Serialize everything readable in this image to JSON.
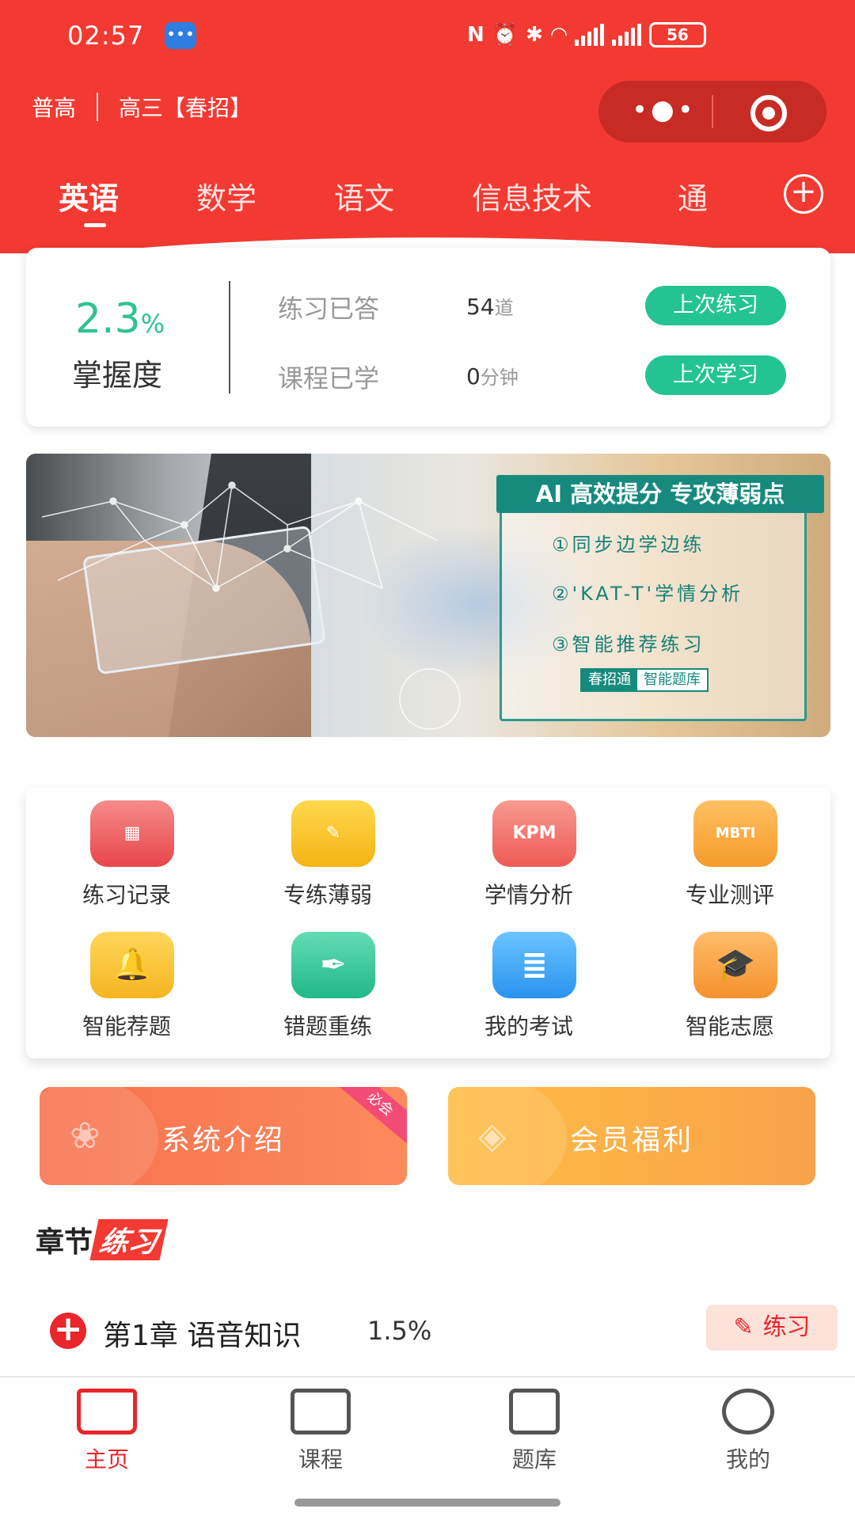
{
  "status_bar": {
    "time": "02:57",
    "battery": "56"
  },
  "header": {
    "level": "普高",
    "grade": "高三【春招】"
  },
  "tabs": [
    "英语",
    "数学",
    "语文",
    "信息技术",
    "通"
  ],
  "stats": {
    "mastery_value": "2.3",
    "mastery_unit": "%",
    "mastery_label": "掌握度",
    "rows": [
      {
        "label": "练习已答",
        "value": "54",
        "unit": "道",
        "button": "上次练习"
      },
      {
        "label": "课程已学",
        "value": "0",
        "unit": "分钟",
        "button": "上次学习"
      }
    ]
  },
  "banner": {
    "title": "AI 高效提分  专攻薄弱点",
    "items": [
      "①同步边学边练",
      "②'KAT-T'学情分析",
      "③智能推荐练习"
    ],
    "tag_primary": "春招通",
    "tag_secondary": "智能题库"
  },
  "grid": [
    {
      "label": "练习记录",
      "icon": "calendar-chart-icon",
      "color_from": "#f58c8a",
      "color_to": "#e8454b"
    },
    {
      "label": "专练薄弱",
      "icon": "pencil-ruler-icon",
      "color_from": "#ffd84d",
      "color_to": "#f5b414"
    },
    {
      "label": "学情分析",
      "icon": "kpm-board-icon",
      "color_from": "#f89a8f",
      "color_to": "#ee5a55"
    },
    {
      "label": "专业测评",
      "icon": "mbti-laptop-icon",
      "color_from": "#ffc062",
      "color_to": "#f59b2a"
    },
    {
      "label": "智能荐题",
      "icon": "bell-icon",
      "color_from": "#ffd65a",
      "color_to": "#f5b521"
    },
    {
      "label": "错题重练",
      "icon": "pen-nib-icon",
      "color_from": "#62dcb4",
      "color_to": "#22b888"
    },
    {
      "label": "我的考试",
      "icon": "document-icon",
      "color_from": "#6ac4ff",
      "color_to": "#2a93ef"
    },
    {
      "label": "智能志愿",
      "icon": "graduation-cap-icon",
      "color_from": "#ffbd6a",
      "color_to": "#f5912e"
    }
  ],
  "features": {
    "intro": "系统介绍",
    "intro_badge": "必会",
    "benefits": "会员福利"
  },
  "section": {
    "title_plain": "章节",
    "title_highlight": "练习"
  },
  "chapter": {
    "name": "第1章  语音知识",
    "percent": "1.5%",
    "button": "练习"
  },
  "tabbar": [
    "主页",
    "课程",
    "题库",
    "我的"
  ],
  "colors": {
    "primary_red": "#f23a32",
    "accent_green": "#24c492",
    "teal": "#178a7e"
  }
}
